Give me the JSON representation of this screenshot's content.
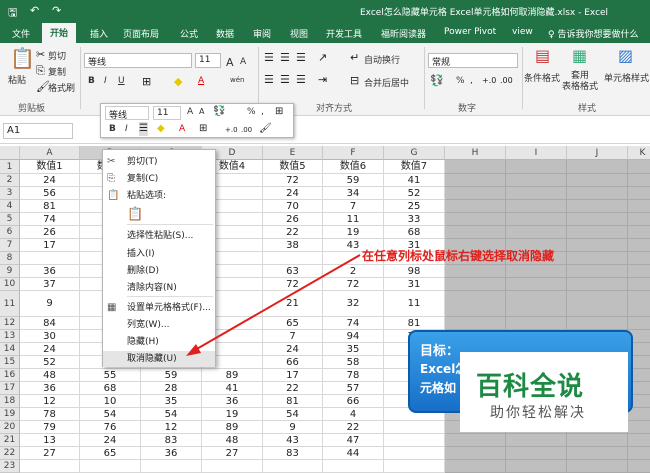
{
  "window": {
    "title": "Excel怎么隐藏单元格 Excel单元格如何取消隐藏.xlsx - Excel",
    "qa_save": "🖫",
    "qa_undo": "↶",
    "qa_redo": "↷"
  },
  "tabs": [
    "文件",
    "开始",
    "插入",
    "页面布局",
    "公式",
    "数据",
    "审阅",
    "视图",
    "开发工具",
    "福昕阅读器",
    "Power Pivot",
    "view"
  ],
  "active_tab": "开始",
  "tell_me": "告诉我你想要做什么",
  "ribbon": {
    "clipboard": {
      "paste": "粘贴",
      "cut": "剪切",
      "copy": "复制",
      "format_painter": "格式刷",
      "group": "剪贴板"
    },
    "font": {
      "name": "等线",
      "size": "11",
      "bold": "B",
      "italic": "I",
      "underline": "U",
      "grow": "A",
      "shrink": "A",
      "wen": "wén"
    },
    "alignment": {
      "wrap": "自动换行",
      "merge": "合并后居中",
      "group": "对齐方式"
    },
    "number": {
      "format": "常规",
      "percent": "%",
      "comma": ",",
      "group": "数字"
    },
    "styles": {
      "conditional": "条件格式",
      "table": "套用\n表格格式",
      "cell_styles": "单元格样式",
      "group": "样式"
    }
  },
  "namebox": "A1",
  "columns": [
    "A",
    "B",
    "C",
    "D",
    "E",
    "F",
    "G",
    "H",
    "I",
    "J",
    "K"
  ],
  "rows": [
    {
      "n": "1",
      "v": [
        "数值1",
        "数值2",
        "数值3",
        "数值4",
        "数值5",
        "数值6",
        "数值7"
      ]
    },
    {
      "n": "2",
      "v": [
        "24",
        "",
        "",
        "",
        "72",
        "59",
        "41"
      ]
    },
    {
      "n": "3",
      "v": [
        "56",
        "",
        "",
        "",
        "24",
        "34",
        "52"
      ]
    },
    {
      "n": "4",
      "v": [
        "81",
        "",
        "",
        "",
        "70",
        "7",
        "25"
      ]
    },
    {
      "n": "5",
      "v": [
        "74",
        "",
        "",
        "",
        "26",
        "11",
        "33"
      ]
    },
    {
      "n": "6",
      "v": [
        "26",
        "",
        "",
        "",
        "22",
        "19",
        "68"
      ]
    },
    {
      "n": "7",
      "v": [
        "17",
        "",
        "",
        "",
        "38",
        "43",
        "31"
      ]
    },
    {
      "n": "8",
      "v": [
        "",
        "",
        "",
        "",
        "",
        "",
        ""
      ]
    },
    {
      "n": "9",
      "v": [
        "36",
        "",
        "",
        "",
        "63",
        "2",
        "98"
      ]
    },
    {
      "n": "10",
      "v": [
        "37",
        "",
        "",
        "",
        "72",
        "72",
        "31"
      ]
    },
    {
      "n": "11",
      "v": [
        "9",
        "",
        "",
        "",
        "21",
        "32",
        "11"
      ]
    },
    {
      "n": "12",
      "v": [
        "84",
        "",
        "",
        "",
        "65",
        "74",
        "81"
      ]
    },
    {
      "n": "13",
      "v": [
        "30",
        "",
        "",
        "",
        "7",
        "94",
        "78"
      ]
    },
    {
      "n": "14",
      "v": [
        "24",
        "",
        "",
        "",
        "24",
        "35",
        "10"
      ]
    },
    {
      "n": "15",
      "v": [
        "52",
        "",
        "",
        "",
        "66",
        "58",
        "76"
      ]
    },
    {
      "n": "16",
      "v": [
        "48",
        "55",
        "59",
        "89",
        "17",
        "78",
        "7"
      ]
    },
    {
      "n": "17",
      "v": [
        "36",
        "68",
        "28",
        "41",
        "22",
        "57",
        ""
      ]
    },
    {
      "n": "18",
      "v": [
        "12",
        "10",
        "35",
        "36",
        "81",
        "66",
        ""
      ]
    },
    {
      "n": "19",
      "v": [
        "78",
        "54",
        "54",
        "19",
        "54",
        "4",
        ""
      ]
    },
    {
      "n": "20",
      "v": [
        "79",
        "76",
        "12",
        "89",
        "9",
        "22",
        ""
      ]
    },
    {
      "n": "21",
      "v": [
        "13",
        "24",
        "83",
        "48",
        "43",
        "47",
        ""
      ]
    },
    {
      "n": "22",
      "v": [
        "27",
        "65",
        "36",
        "27",
        "83",
        "44",
        ""
      ]
    },
    {
      "n": "23",
      "v": [
        "",
        "",
        "",
        "",
        "",
        "",
        ""
      ]
    }
  ],
  "mini_toolbar": {
    "font": "等线",
    "size": "11",
    "percent": "%",
    "comma": ","
  },
  "context_menu": [
    {
      "label": "剪切(T)",
      "icon": "✂"
    },
    {
      "label": "复制(C)",
      "icon": "⎘"
    },
    {
      "label": "粘贴选项:",
      "icon": "📋"
    },
    {
      "label": "",
      "icon": ""
    },
    {
      "label": "选择性粘贴(S)...",
      "icon": ""
    },
    {
      "label": "插入(I)",
      "icon": ""
    },
    {
      "label": "删除(D)",
      "icon": ""
    },
    {
      "label": "清除内容(N)",
      "icon": ""
    },
    {
      "label": "设置单元格格式(F)...",
      "icon": "▦"
    },
    {
      "label": "列宽(W)...",
      "icon": ""
    },
    {
      "label": "隐藏(H)",
      "icon": ""
    },
    {
      "label": "取消隐藏(U)",
      "icon": ""
    }
  ],
  "annotation": "在任意列标处鼠标右键选择取消隐藏",
  "goal_box": {
    "title": "目标：",
    "line1": "Excel怎",
    "line2": "元格如"
  },
  "watermark": {
    "title": "百科全说",
    "subtitle": "助你轻松解决"
  }
}
